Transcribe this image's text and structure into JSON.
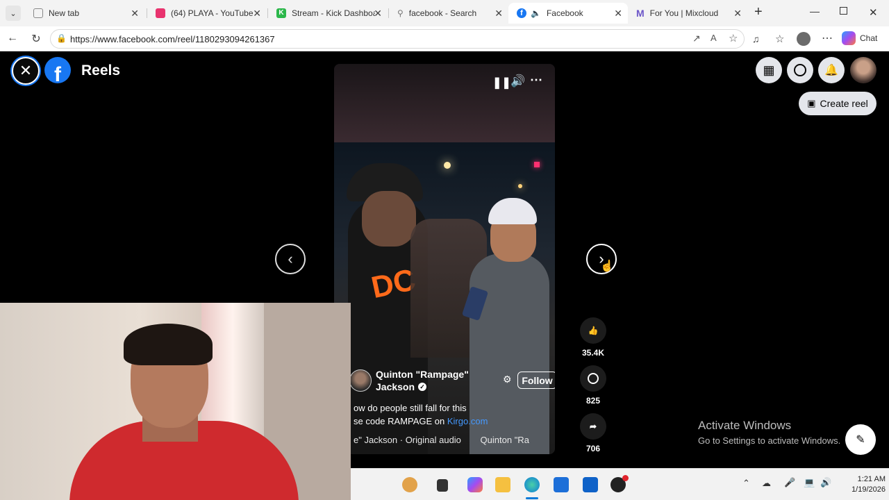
{
  "browser": {
    "tabs": [
      {
        "title": "New tab",
        "icon": "page-icon",
        "color": "#888888"
      },
      {
        "title": "(64) PLAYA - YouTube",
        "icon": "youtube-icon",
        "color": "#e8336e"
      },
      {
        "title": "Stream - Kick Dashboard",
        "icon": "kick-icon",
        "color": "#2bb74a"
      },
      {
        "title": "facebook - Search",
        "icon": "search-icon",
        "color": "#777777"
      },
      {
        "title": "Facebook",
        "icon": "facebook-icon",
        "color": "#1877f2",
        "active": true
      },
      {
        "title": "For You | Mixcloud",
        "icon": "mixcloud-icon",
        "color": "#6b55c8"
      }
    ],
    "new_tab": "+",
    "url": "https://www.facebook.com/reel/1180293094261367",
    "chat_label": "Chat"
  },
  "facebook": {
    "page_title": "Reels",
    "create_reel": "Create reel",
    "accent": "#1877f2"
  },
  "reel": {
    "author_line1": "Quinton \"Rampage\"",
    "author_line2": "Jackson",
    "follow": "Follow",
    "caption_line1": "ow do people still fall for this",
    "caption_line2_prefix": "se code RAMPAGE on ",
    "caption_link": "Kirgo.com",
    "audio_left": "e\" Jackson · Original audio",
    "audio_right": "Quinton \"Ra",
    "likes": "35.4K",
    "comments": "825",
    "shares": "706"
  },
  "watermark": {
    "line1": "Activate Windows",
    "line2": "Go to Settings to activate Windows."
  },
  "taskbar": {
    "time": "1:21 AM",
    "date": "1/19/2026"
  }
}
